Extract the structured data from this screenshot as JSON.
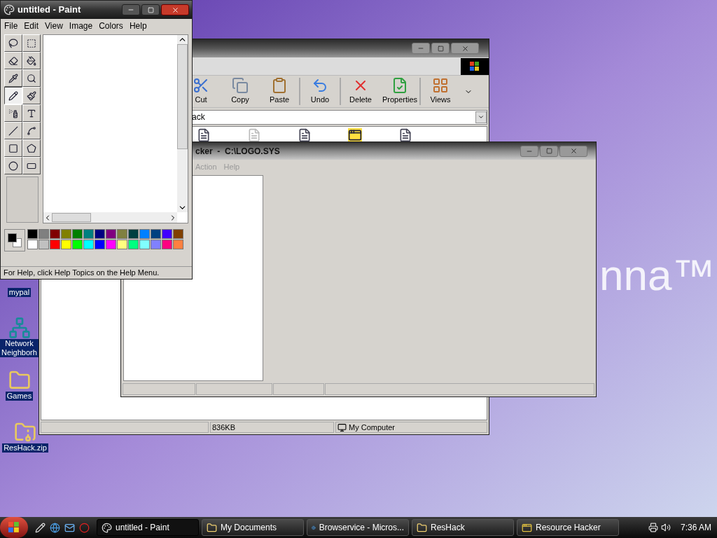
{
  "desktop": {
    "logo_text": "nna™",
    "icons": [
      {
        "kind": "app",
        "lines": [
          "mypal"
        ]
      },
      {
        "kind": "network",
        "lines": [
          "Network",
          "Neighborh"
        ]
      },
      {
        "kind": "folder",
        "lines": [
          "Games"
        ]
      },
      {
        "kind": "zip",
        "lines": [
          "ResHack.zip"
        ]
      }
    ]
  },
  "explorer_window": {
    "toolbar": [
      {
        "kind": "cut",
        "label": "Cut",
        "separator_before": false
      },
      {
        "kind": "copy",
        "label": "Copy",
        "separator_before": false
      },
      {
        "kind": "paste",
        "label": "Paste",
        "separator_before": false
      },
      {
        "kind": "undo",
        "label": "Undo",
        "separator_before": true
      },
      {
        "kind": "delete",
        "label": "Delete",
        "separator_before": true
      },
      {
        "kind": "properties",
        "label": "Properties",
        "separator_before": false
      },
      {
        "kind": "views",
        "label": "Views",
        "separator_before": true
      }
    ],
    "address": "ack",
    "status_bar": [
      "836KB",
      "My Computer"
    ]
  },
  "resource_hacker_window": {
    "title": "cker  -  C:\\LOGO.SYS",
    "menu": [
      {
        "label": "Action",
        "disabled": true
      },
      {
        "label": "Help",
        "disabled": true
      }
    ]
  },
  "paint_window": {
    "title": "untitled - Paint",
    "menu": [
      "File",
      "Edit",
      "View",
      "Image",
      "Colors",
      "Help"
    ],
    "tools": [
      {
        "kind": "free-select",
        "selected": false
      },
      {
        "kind": "select",
        "selected": false
      },
      {
        "kind": "eraser",
        "selected": false
      },
      {
        "kind": "fill",
        "selected": false
      },
      {
        "kind": "pick-color",
        "selected": false
      },
      {
        "kind": "magnifier",
        "selected": false
      },
      {
        "kind": "pencil",
        "selected": true
      },
      {
        "kind": "brush",
        "selected": false
      },
      {
        "kind": "airbrush",
        "selected": false
      },
      {
        "kind": "text",
        "selected": false
      },
      {
        "kind": "line",
        "selected": false
      },
      {
        "kind": "curve",
        "selected": false
      },
      {
        "kind": "rectangle",
        "selected": false
      },
      {
        "kind": "polygon",
        "selected": false
      },
      {
        "kind": "ellipse",
        "selected": false
      },
      {
        "kind": "rounded-rectangle",
        "selected": false
      }
    ],
    "palette": [
      {
        "color": "#000000"
      },
      {
        "color": "#808080"
      },
      {
        "color": "#800000"
      },
      {
        "color": "#808000"
      },
      {
        "color": "#008000"
      },
      {
        "color": "#008080"
      },
      {
        "color": "#000080"
      },
      {
        "color": "#800080"
      },
      {
        "color": "#808040"
      },
      {
        "color": "#004040"
      },
      {
        "color": "#0080ff"
      },
      {
        "color": "#004080"
      },
      {
        "color": "#4000ff"
      },
      {
        "color": "#804000"
      },
      {
        "color": "#ffffff"
      },
      {
        "color": "#c0c0c0"
      },
      {
        "color": "#ff0000"
      },
      {
        "color": "#ffff00"
      },
      {
        "color": "#00ff00"
      },
      {
        "color": "#00ffff"
      },
      {
        "color": "#0000ff"
      },
      {
        "color": "#ff00ff"
      },
      {
        "color": "#ffff80"
      },
      {
        "color": "#00ff80"
      },
      {
        "color": "#80ffff"
      },
      {
        "color": "#8080ff"
      },
      {
        "color": "#ff0080"
      },
      {
        "color": "#ff8040"
      }
    ],
    "status": "For Help, click Help Topics on the Help Menu."
  },
  "taskbar": {
    "buttons": [
      {
        "kind": "paint",
        "label": "untitled - Paint",
        "selected": true
      },
      {
        "kind": "folder",
        "label": "My Documents",
        "selected": false
      },
      {
        "kind": "browser",
        "label": "Browservice - Micros...",
        "selected": false
      },
      {
        "kind": "folder",
        "label": "ResHack",
        "selected": false
      },
      {
        "kind": "app",
        "label": "Resource Hacker",
        "selected": false
      }
    ],
    "clock": "7:36 AM"
  }
}
